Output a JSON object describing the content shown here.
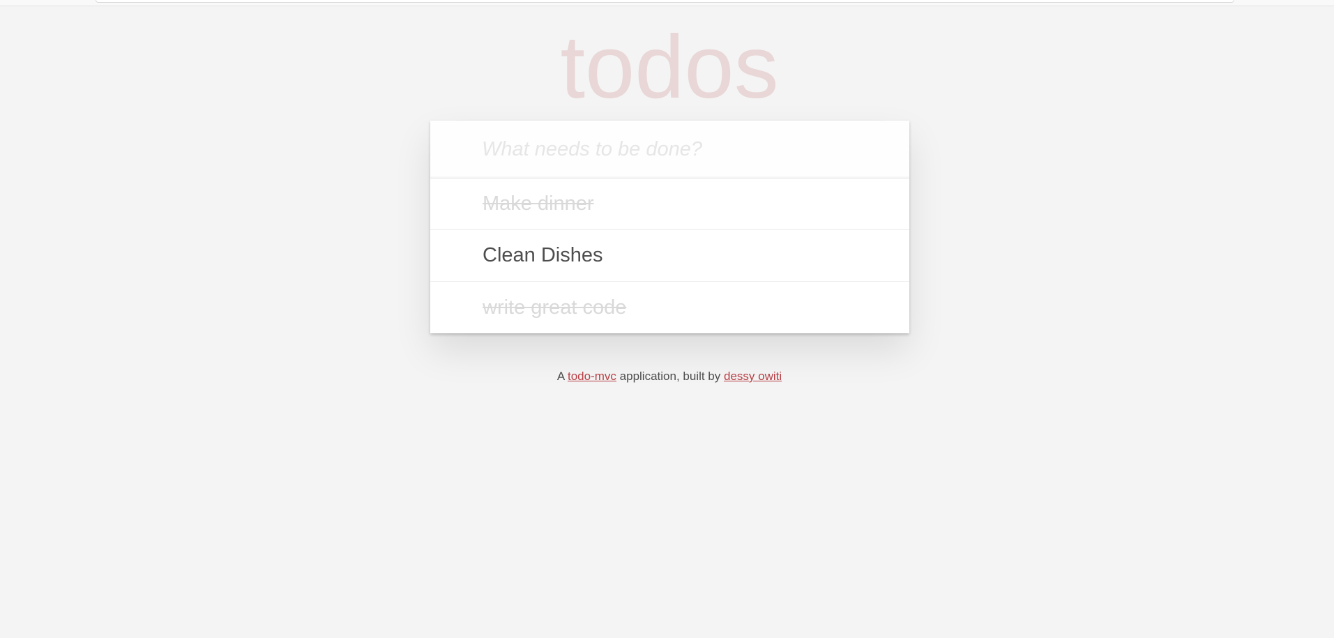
{
  "app": {
    "title": "todos"
  },
  "new_todo": {
    "placeholder": "What needs to be done?",
    "value": ""
  },
  "todos": [
    {
      "label": "Make dinner",
      "completed": true
    },
    {
      "label": "Clean Dishes",
      "completed": false
    },
    {
      "label": "write great code",
      "completed": true
    }
  ],
  "footer": {
    "prefix": "A",
    "link1": "todo-mvc",
    "middle": "application, built by",
    "link2": "dessy owiti"
  },
  "colors": {
    "background": "#f4f4f4",
    "title": "#efd9d9",
    "link": "#b83f45",
    "completed_text": "#d9d9d9",
    "active_text": "#4d4d4d"
  }
}
